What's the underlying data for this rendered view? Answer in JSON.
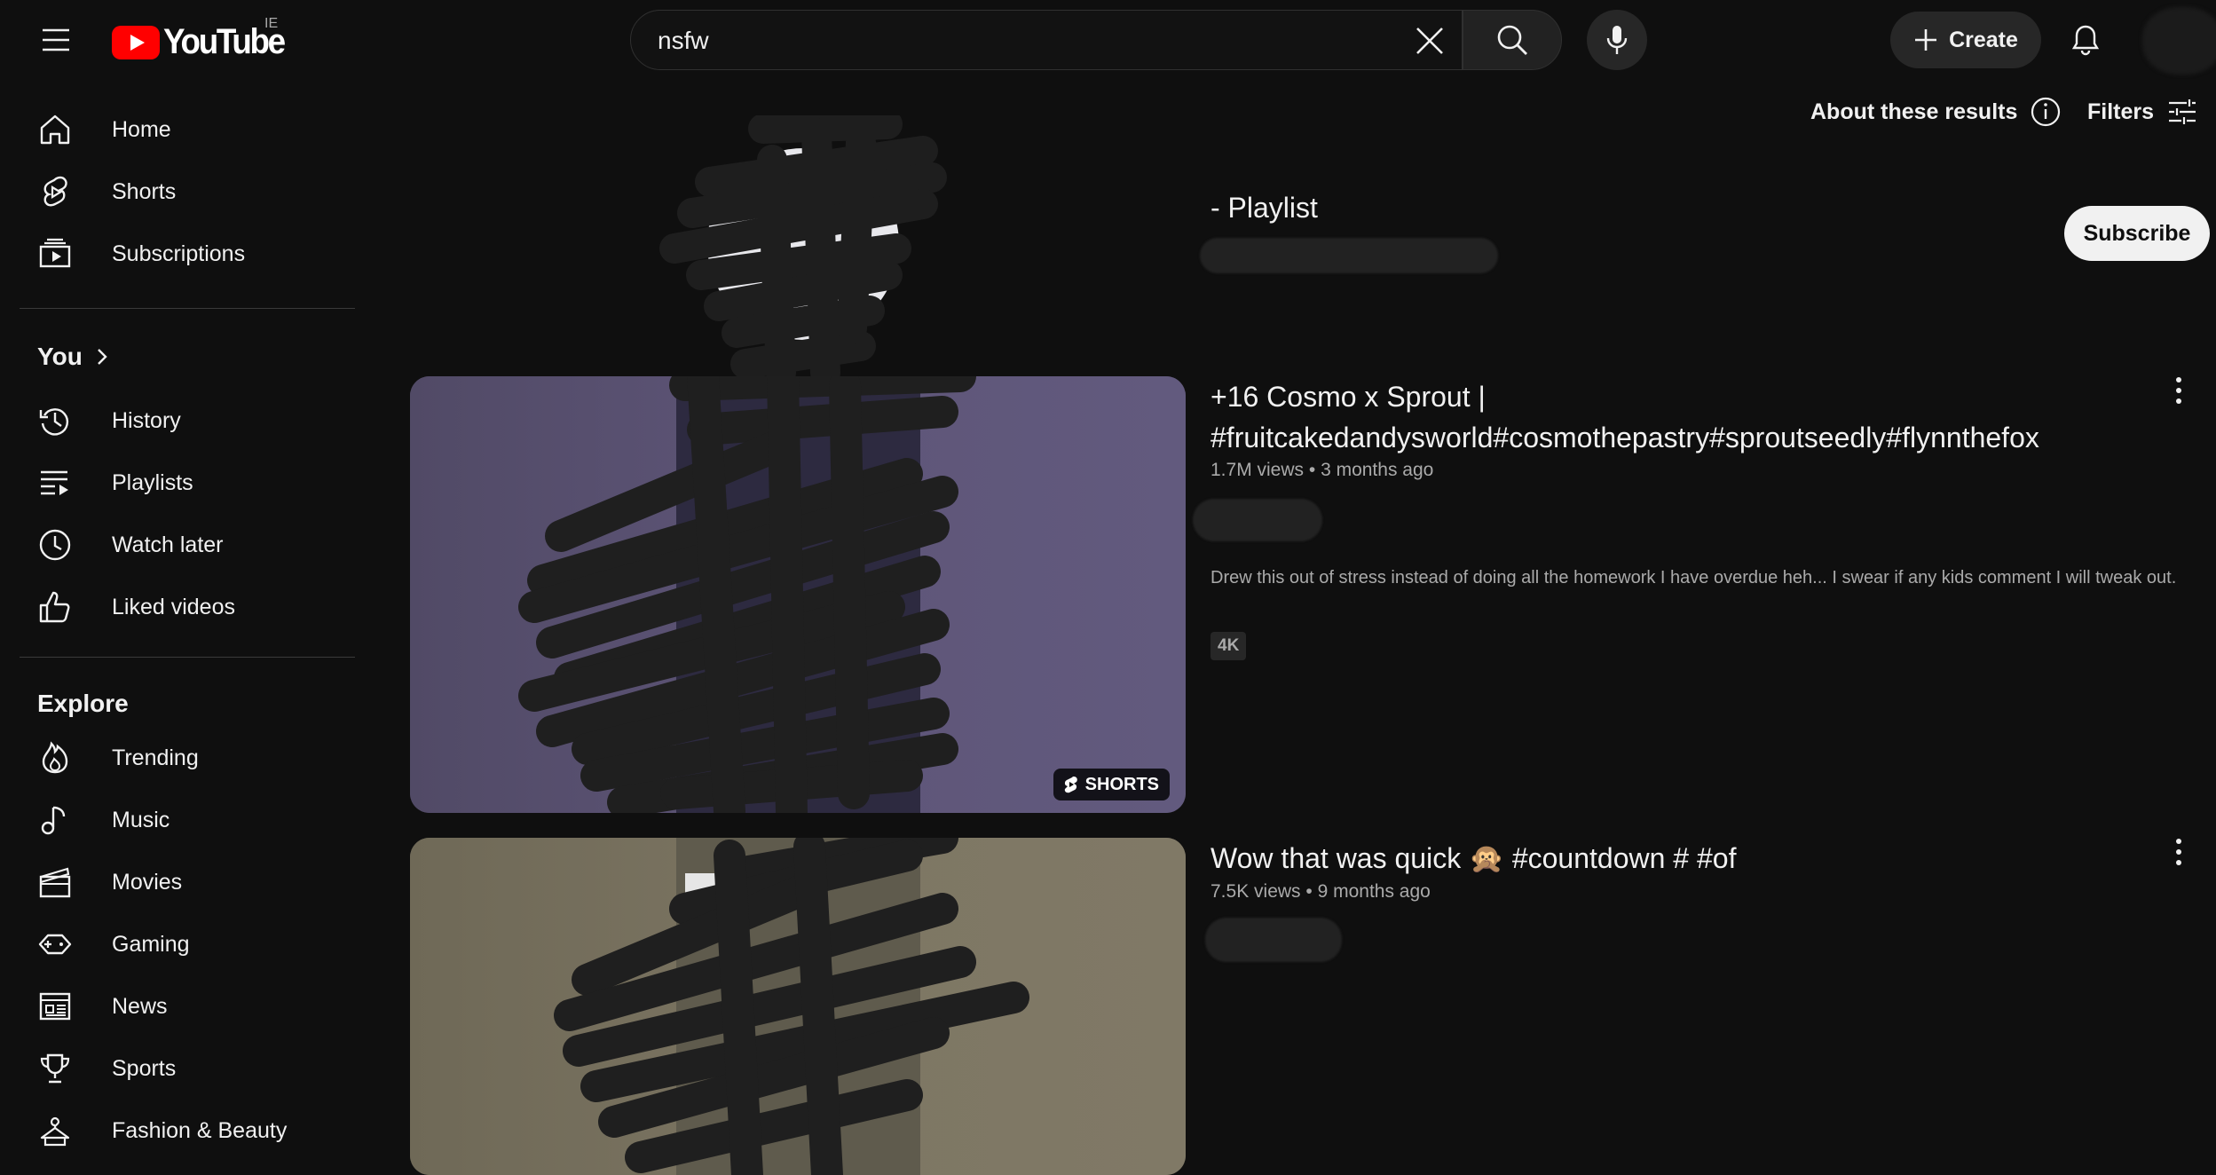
{
  "header": {
    "logo_text": "YouTube",
    "region": "IE",
    "search_value": "nsfw",
    "search_placeholder": "Search",
    "create_label": "Create"
  },
  "sidebar": {
    "main": [
      {
        "label": "Home",
        "icon": "home-icon"
      },
      {
        "label": "Shorts",
        "icon": "shorts-icon"
      },
      {
        "label": "Subscriptions",
        "icon": "subscriptions-icon"
      }
    ],
    "you_heading": "You",
    "you": [
      {
        "label": "History",
        "icon": "history-icon"
      },
      {
        "label": "Playlists",
        "icon": "playlists-icon"
      },
      {
        "label": "Watch later",
        "icon": "watch-later-icon"
      },
      {
        "label": "Liked videos",
        "icon": "thumbs-up-icon"
      }
    ],
    "explore_heading": "Explore",
    "explore": [
      {
        "label": "Trending",
        "icon": "trending-icon"
      },
      {
        "label": "Music",
        "icon": "music-icon"
      },
      {
        "label": "Movies",
        "icon": "movies-icon"
      },
      {
        "label": "Gaming",
        "icon": "gaming-icon"
      },
      {
        "label": "News",
        "icon": "news-icon"
      },
      {
        "label": "Sports",
        "icon": "sports-icon"
      },
      {
        "label": "Fashion & Beauty",
        "icon": "fashion-icon"
      }
    ]
  },
  "results_header": {
    "about_label": "About these results",
    "filters_label": "Filters"
  },
  "channel_result": {
    "title": "- Playlist",
    "subscribe_label": "Subscribe"
  },
  "videos": [
    {
      "title": "+16 Cosmo x Sprout | #fruitcakedandysworld#cosmothepastry#sproutseedly#flynnthefox",
      "views": "1.7M views",
      "age": "3 months ago",
      "description": "Drew this out of stress instead of doing all the homework I have overdue heh... I swear if any kids comment I will tweak out.",
      "badge": "4K",
      "overlay": "SHORTS",
      "thumb_color": "#5b5272"
    },
    {
      "title": "Wow that was quick 🙊 #countdown # #of",
      "views": "7.5K views",
      "age": "9 months ago",
      "thumb_color": "#7b7462"
    }
  ],
  "colors": {
    "background": "#0f0f0f",
    "brand_red": "#ff0000",
    "text_primary": "#f1f1f1",
    "text_secondary": "#aaaaaa",
    "redaction": "#222222"
  }
}
